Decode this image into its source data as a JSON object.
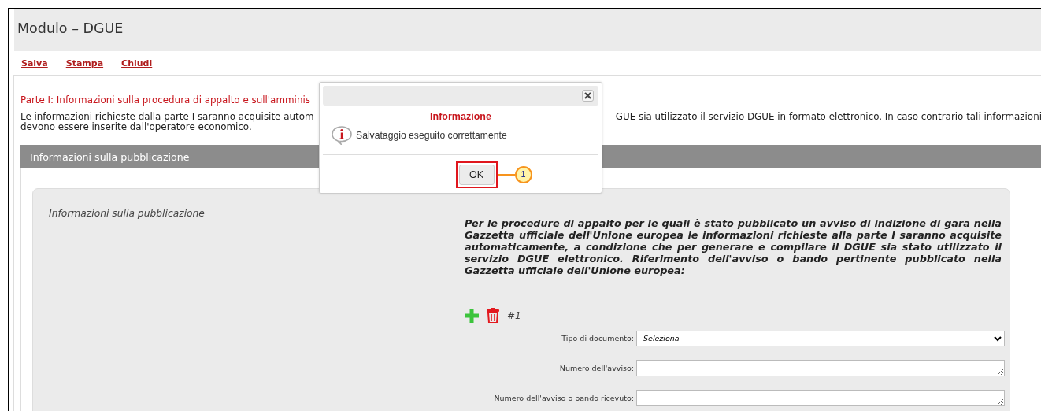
{
  "window": {
    "title": "Modulo – DGUE"
  },
  "toolbar": [
    {
      "label": "Salva"
    },
    {
      "label": "Stampa"
    },
    {
      "label": "Chiudi"
    }
  ],
  "section": {
    "heading": "Parte I: Informazioni sulla procedura di appalto e sull'amminis",
    "intro_line_1_left": "Le informazioni richieste dalla parte I saranno acquisite autom",
    "intro_line_1_right": "GUE sia utilizzato il servizio DGUE in formato elettronico. In caso contrario tali informazioni",
    "intro_line_2": "devono essere inserite dall'operatore economico."
  },
  "panel": {
    "header": "Informazioni sulla pubblicazione",
    "label": "Informazioni sulla pubblicazione",
    "description": "Per le procedure di appalto per le quali è stato pubblicato un avviso di indizione di gara nella Gazzetta ufficiale dell'Unione europea le informazioni richieste alla parte I saranno acquisite automaticamente, a condizione che per generare e compilare il DGUE sia stato utilizzato il servizio DGUE elettronico. Riferimento dell'avviso o bando pertinente pubblicato nella Gazzetta ufficiale dell'Unione europea:",
    "item_number": "#1",
    "fields": [
      {
        "kind": "select",
        "label": "Tipo di documento:",
        "value": "Seleziona"
      },
      {
        "kind": "textarea",
        "label": "Numero dell'avviso:"
      },
      {
        "kind": "textarea",
        "label": "Numero dell'avviso o bando ricevuto:"
      }
    ]
  },
  "dialog": {
    "title": "Informazione",
    "message": "Salvataggio eseguito correttamente",
    "button": "OK",
    "callout": "1"
  }
}
